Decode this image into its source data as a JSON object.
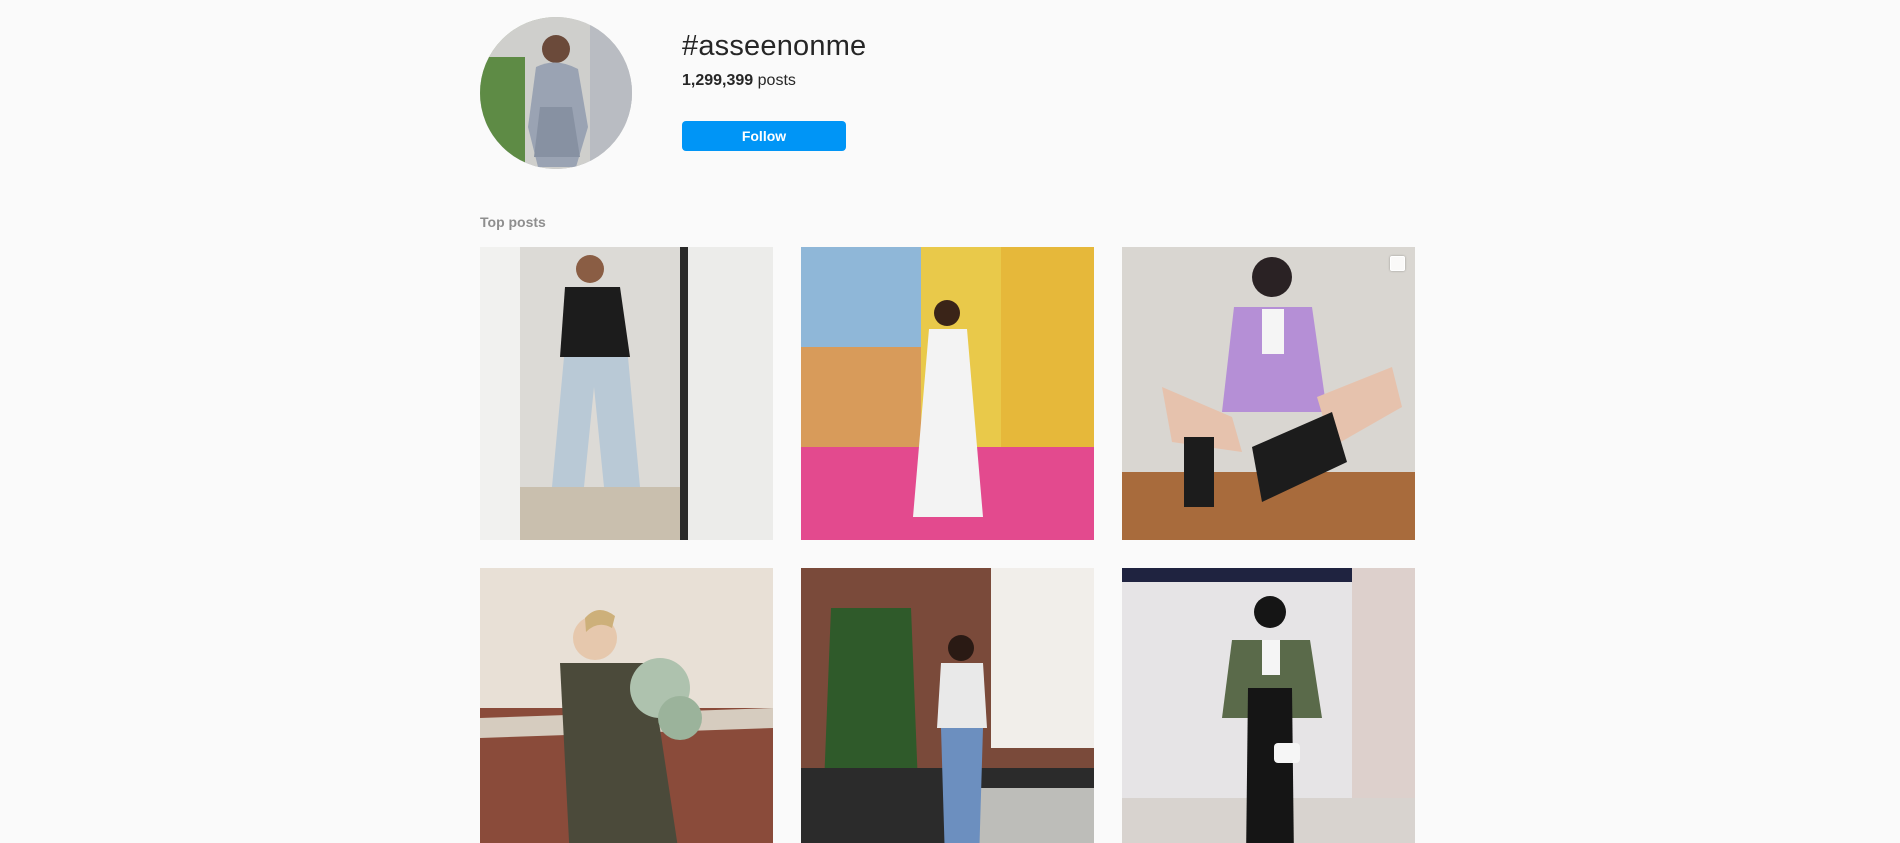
{
  "header": {
    "hashtag": "#asseenonme",
    "post_count": "1,299,399",
    "post_label": "posts",
    "follow_label": "Follow"
  },
  "top_posts": {
    "title": "Top posts",
    "posts": [
      {
        "subject": "mirror selfie black top light jeans",
        "colors": {
          "bg": "#dcdad6",
          "accent": "#1c1c1c"
        }
      },
      {
        "subject": "white dress pink street colorful buildings",
        "colors": {
          "bg": "#e9c94a",
          "accent": "#e34a8e"
        }
      },
      {
        "subject": "lilac cardigan black boots bench",
        "colors": {
          "bg": "#d9d6d1",
          "accent": "#b58fd6"
        },
        "icon": "multiple-photos-icon"
      },
      {
        "subject": "woman olive coat holding eucalyptus",
        "colors": {
          "bg": "#e8e0d6",
          "accent": "#4b4a3a"
        }
      },
      {
        "subject": "zebra shirt jeans street trees",
        "colors": {
          "bg": "#7a4a3a",
          "accent": "#2f5a2a"
        }
      },
      {
        "subject": "camo jacket black skirt store front",
        "colors": {
          "bg": "#e6e4e6",
          "accent": "#5a6a4a"
        }
      }
    ]
  }
}
